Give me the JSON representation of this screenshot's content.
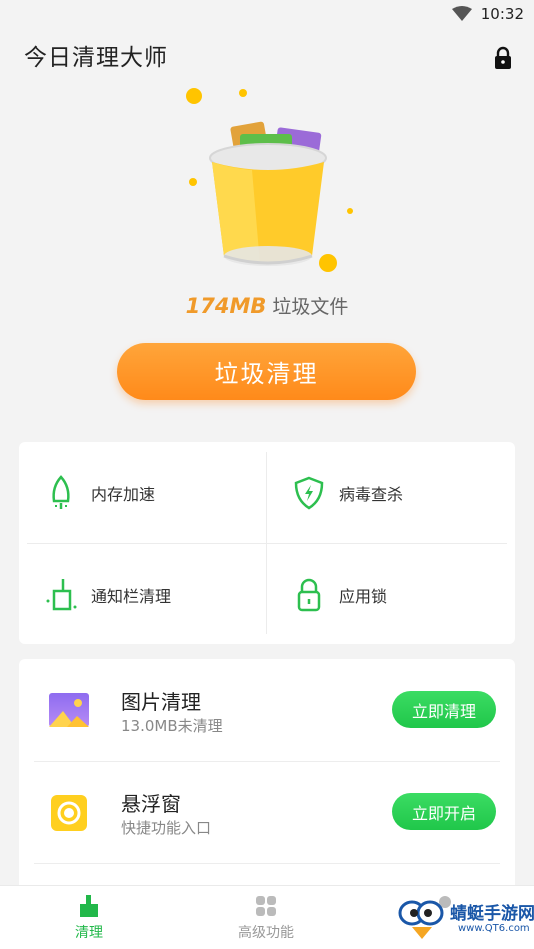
{
  "status_bar": {
    "time": "10:32",
    "wifi_icon": "wifi-icon"
  },
  "header": {
    "title": "今日清理大师",
    "lock_icon": "lock-icon"
  },
  "hero": {
    "junk_size": "174MB",
    "junk_label": "垃圾文件",
    "clean_button": "垃圾清理"
  },
  "tools": [
    {
      "label": "内存加速",
      "icon": "rocket-icon"
    },
    {
      "label": "病毒查杀",
      "icon": "shield-icon"
    },
    {
      "label": "通知栏清理",
      "icon": "broom-icon"
    },
    {
      "label": "应用锁",
      "icon": "padlock-icon"
    }
  ],
  "features": [
    {
      "title": "图片清理",
      "subtitle": "13.0MB未清理",
      "action": "立即清理",
      "icon": "picture-icon"
    },
    {
      "title": "悬浮窗",
      "subtitle": "快捷功能入口",
      "action": "立即开启",
      "icon": "float-window-icon"
    }
  ],
  "nav": [
    {
      "label": "清理",
      "icon": "clean-icon",
      "active": true
    },
    {
      "label": "高级功能",
      "icon": "grid-icon",
      "active": false
    }
  ],
  "watermark": {
    "text": "蜻蜓手游网",
    "sub": "www.QT6.com"
  },
  "colors": {
    "accent_orange": "#ff8a1a",
    "accent_green": "#22b84a",
    "junk_size": "#f09a2a"
  }
}
